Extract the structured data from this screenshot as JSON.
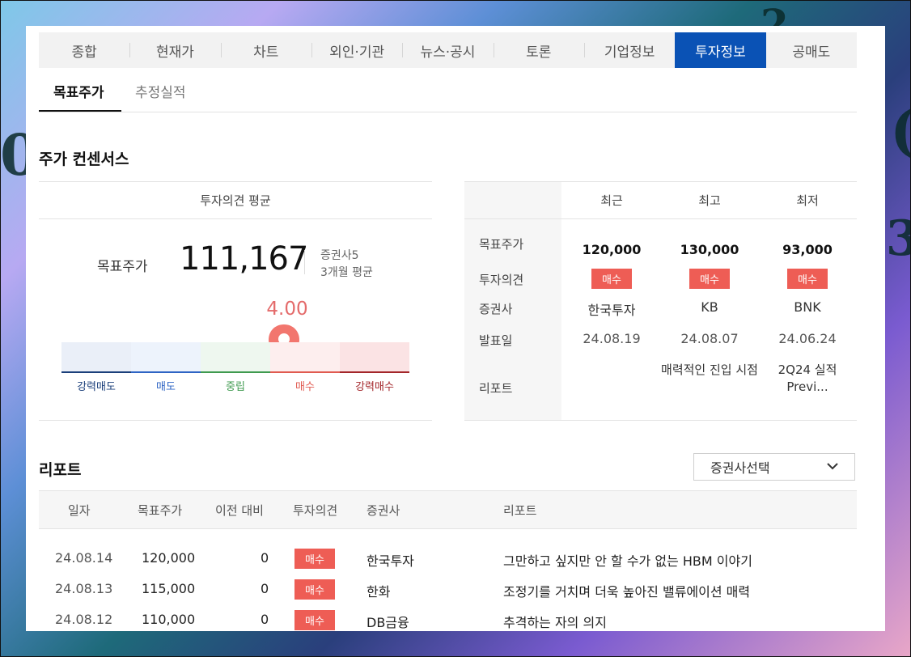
{
  "tabs": [
    "종합",
    "현재가",
    "차트",
    "외인·기관",
    "뉴스·공시",
    "토론",
    "기업정보",
    "투자정보",
    "공매도"
  ],
  "active_tab": "투자정보",
  "subtabs": [
    "목표주가",
    "추정실적"
  ],
  "active_subtab": "목표주가",
  "consensus": {
    "title": "주가 컨센서스",
    "opinion_header": "투자의견 평균",
    "target_label": "목표주가",
    "target_value": "111,167",
    "broker_count": "증권사5",
    "period": "3개월 평균",
    "score": "4.00",
    "score_numeric": 4.0,
    "gauge_labels": [
      "강력매도",
      "매도",
      "중립",
      "매수",
      "강력매수"
    ],
    "gauge_colors": {
      "strong_sell": "#1b3f7a",
      "sell": "#2e64c4",
      "neutral": "#3f9a4f",
      "buy": "#e05a50",
      "strong_buy": "#a3262a"
    }
  },
  "summary": {
    "headers": [
      "최근",
      "최고",
      "최저"
    ],
    "row_labels": [
      "목표주가",
      "투자의견",
      "증권사",
      "발표일",
      "리포트"
    ],
    "columns": [
      {
        "price": "120,000",
        "opinion": "매수",
        "broker": "한국투자",
        "date": "24.08.19",
        "report": ""
      },
      {
        "price": "130,000",
        "opinion": "매수",
        "broker": "KB",
        "date": "24.08.07",
        "report": "매력적인 진입 시점"
      },
      {
        "price": "93,000",
        "opinion": "매수",
        "broker": "BNK",
        "date": "24.06.24",
        "report": "2Q24 실적 Previ..."
      }
    ]
  },
  "reports": {
    "title": "리포트",
    "select_label": "증권사선택",
    "headers": [
      "일자",
      "목표주가",
      "이전 대비",
      "투자의견",
      "증권사",
      "리포트"
    ],
    "rows": [
      {
        "date": "24.08.14",
        "price": "120,000",
        "change": "0",
        "opinion": "매수",
        "broker": "한국투자",
        "title": "그만하고 싶지만 안 할 수가 없는 HBM 이야기"
      },
      {
        "date": "24.08.13",
        "price": "115,000",
        "change": "0",
        "opinion": "매수",
        "broker": "한화",
        "title": "조정기를 거치며 더욱 높아진 밸류에이션 매력"
      },
      {
        "date": "24.08.12",
        "price": "110,000",
        "change": "0",
        "opinion": "매수",
        "broker": "DB금융",
        "title": "추격하는 자의 의지"
      }
    ]
  },
  "colors": {
    "accent": "#0a52b5",
    "buy_badge": "#ee5d55",
    "score": "#e46b6b"
  }
}
